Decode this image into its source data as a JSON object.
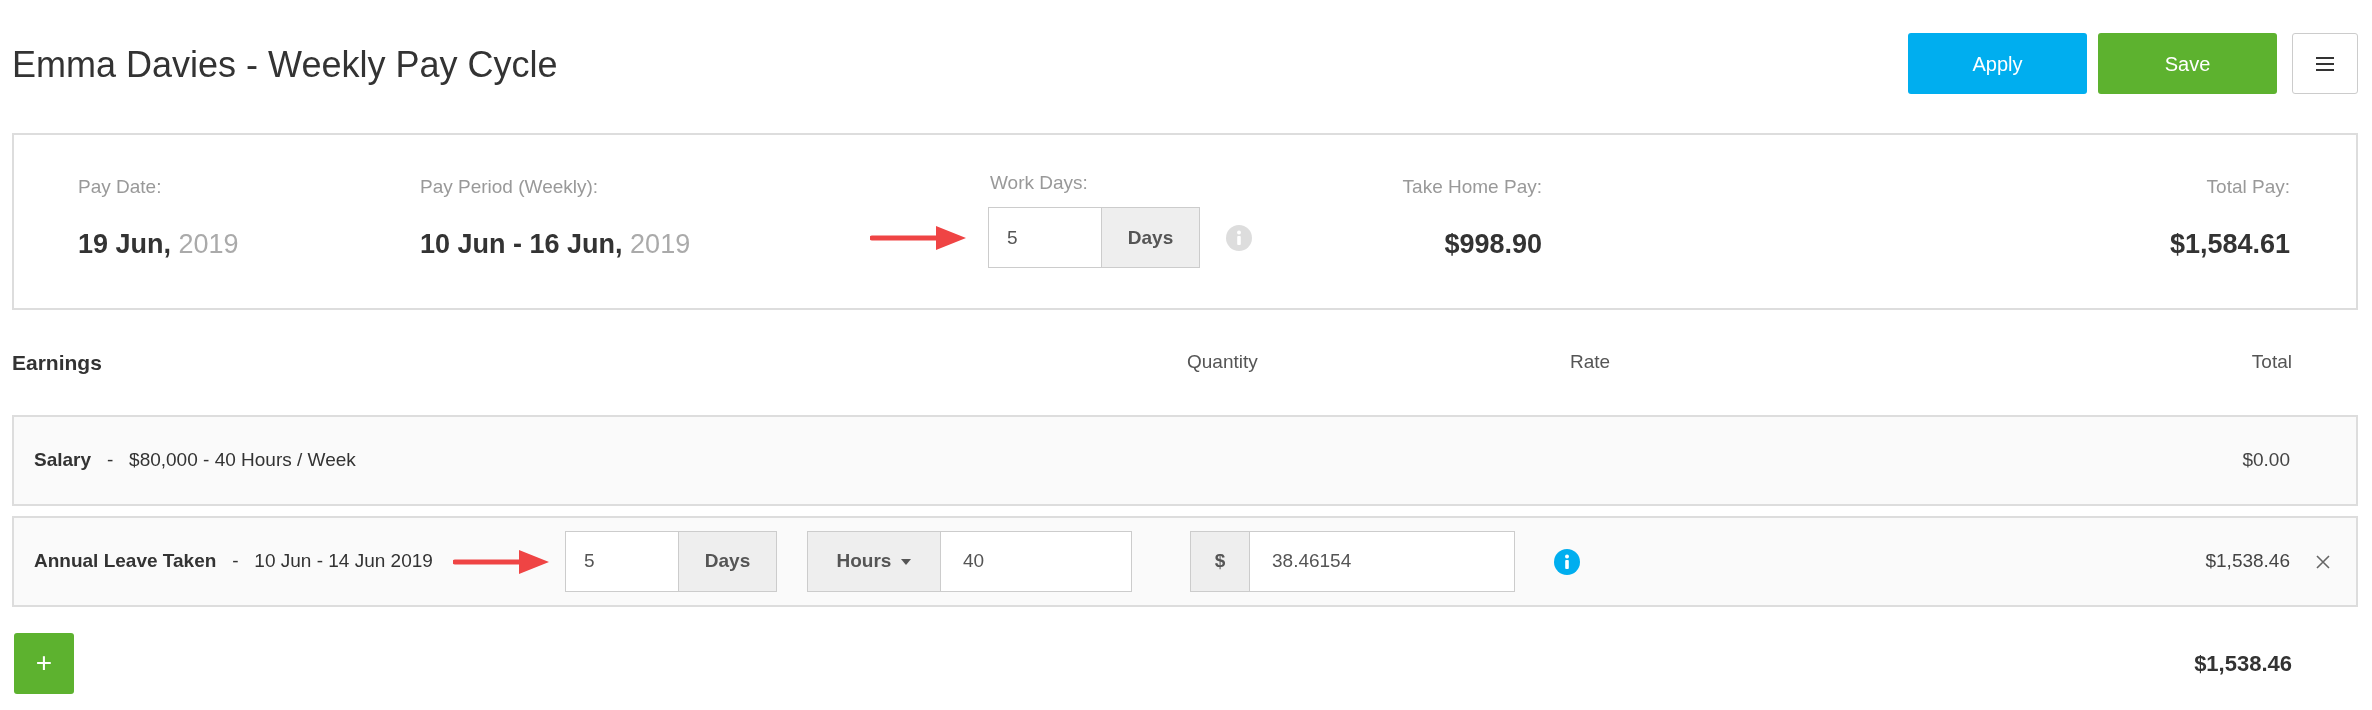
{
  "header": {
    "name": "Emma Davies",
    "subtitle": "- Weekly Pay Cycle",
    "buttons": [
      {
        "label": "Apply",
        "kind": "primary"
      },
      {
        "label": "Save",
        "kind": "success"
      }
    ]
  },
  "summary": {
    "pay_date": {
      "label": "Pay Date:",
      "day": "19 Jun,",
      "year": "2019"
    },
    "pay_period": {
      "label": "Pay Period (Weekly):",
      "range": "10 Jun - 16 Jun,",
      "year": "2019"
    },
    "work_days": {
      "label": "Work Days:",
      "value": "5",
      "unit": "Days"
    },
    "take_home": {
      "label": "Take Home Pay:",
      "value": "$998.90"
    },
    "total_pay": {
      "label": "Total Pay:",
      "value": "$1,584.61"
    }
  },
  "earnings": {
    "title": "Earnings",
    "columns": [
      "Quantity",
      "Rate",
      "Total"
    ],
    "rows": [
      {
        "kind": "fixed",
        "name": "Salary",
        "separator": "-",
        "detail": "$80,000 - 40 Hours / Week",
        "total": "$0.00"
      },
      {
        "kind": "editable",
        "name": "Annual Leave Taken",
        "separator": "-",
        "detail": "10 Jun - 14 Jun 2019",
        "days_value": "5",
        "days_unit": "Days",
        "quantity_unit": "Hours",
        "quantity": "40",
        "rate_prefix": "$",
        "rate": "38.46154",
        "total": "$1,538.46"
      }
    ],
    "add_button": "+",
    "grand_total": "$1,538.46"
  }
}
